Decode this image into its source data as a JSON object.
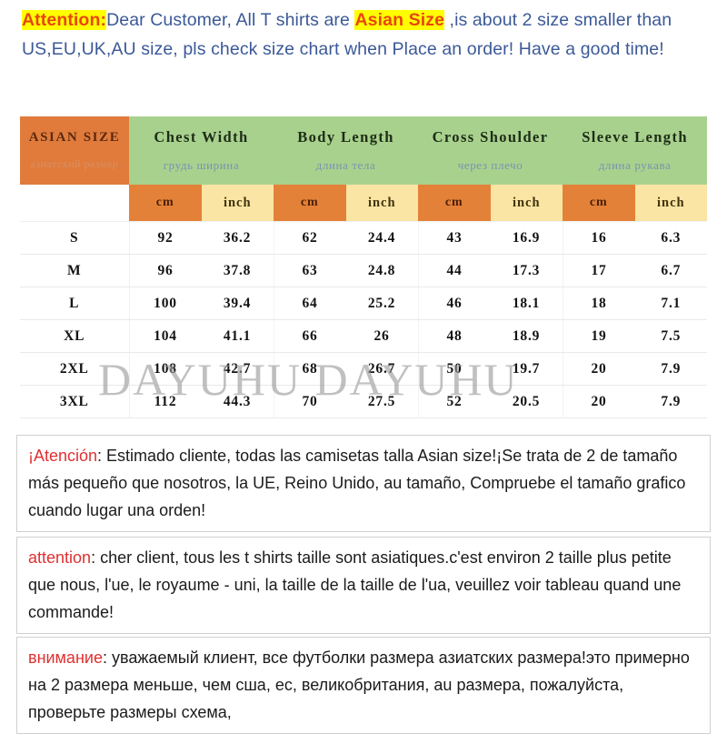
{
  "top_notice": {
    "attention_label": "Attention:",
    "text_part1": "Dear Customer, All T shirts are ",
    "asian_size_label": "Asian Size",
    "text_part2": " ,is about 2 size smaller than US,EU,UK,AU size, pls check size chart when Place an order! Have a good time!"
  },
  "table": {
    "size_header_en": "ASIAN SIZE",
    "size_header_ru": "азиатский размер",
    "measure_headers": [
      {
        "en": "Chest Width",
        "ru": "грудь ширина"
      },
      {
        "en": "Body Length",
        "ru": "длина тела"
      },
      {
        "en": "Cross Shoulder",
        "ru": "через плечо"
      },
      {
        "en": "Sleeve Length",
        "ru": "длина рукава"
      }
    ],
    "unit_cm": "cm",
    "unit_inch": "inch",
    "rows": [
      {
        "size": "S",
        "chest_cm": "92",
        "chest_in": "36.2",
        "body_cm": "62",
        "body_in": "24.4",
        "shoulder_cm": "43",
        "shoulder_in": "16.9",
        "sleeve_cm": "16",
        "sleeve_in": "6.3"
      },
      {
        "size": "M",
        "chest_cm": "96",
        "chest_in": "37.8",
        "body_cm": "63",
        "body_in": "24.8",
        "shoulder_cm": "44",
        "shoulder_in": "17.3",
        "sleeve_cm": "17",
        "sleeve_in": "6.7"
      },
      {
        "size": "L",
        "chest_cm": "100",
        "chest_in": "39.4",
        "body_cm": "64",
        "body_in": "25.2",
        "shoulder_cm": "46",
        "shoulder_in": "18.1",
        "sleeve_cm": "18",
        "sleeve_in": "7.1"
      },
      {
        "size": "XL",
        "chest_cm": "104",
        "chest_in": "41.1",
        "body_cm": "66",
        "body_in": "26",
        "shoulder_cm": "48",
        "shoulder_in": "18.9",
        "sleeve_cm": "19",
        "sleeve_in": "7.5"
      },
      {
        "size": "2XL",
        "chest_cm": "108",
        "chest_in": "42.7",
        "body_cm": "68",
        "body_in": "26.7",
        "shoulder_cm": "50",
        "shoulder_in": "19.7",
        "sleeve_cm": "20",
        "sleeve_in": "7.9"
      },
      {
        "size": "3XL",
        "chest_cm": "112",
        "chest_in": "44.3",
        "body_cm": "70",
        "body_in": "27.5",
        "shoulder_cm": "52",
        "shoulder_in": "20.5",
        "sleeve_cm": "20",
        "sleeve_in": "7.9"
      }
    ]
  },
  "watermark": "DAYUHU DAYUHU",
  "notices": {
    "spanish": {
      "keyword": "¡Atención",
      "body": ": Estimado cliente, todas las camisetas talla Asian size!¡Se trata de 2 de tamaño más pequeño que nosotros, la UE, Reino Unido, au tamaño, Compruebe el tamaño grafico cuando lugar una orden!"
    },
    "french": {
      "keyword": "attention",
      "body": ": cher client, tous les t shirts taille sont asiatiques.c'est environ 2 taille plus petite que nous, l'ue, le royaume - uni, la taille de la taille de l'ua, veuillez voir tableau quand une commande!"
    },
    "russian": {
      "keyword": "внимание",
      "body": ": уважаемый клиент, все футболки размера азиатских размера!это примерно на 2 размера меньше, чем сша, ес, великобритания, au размера, пожалуйста, проверьте размеры схема,"
    }
  },
  "colors": {
    "orange": "#e07b3c",
    "green": "#a9d18e",
    "inch_yellow": "#fbe5a4",
    "highlight_yellow": "#ffff00",
    "attention_red": "#e8460e",
    "notice_blue": "#3b5998",
    "keyword_red": "#e03030"
  }
}
